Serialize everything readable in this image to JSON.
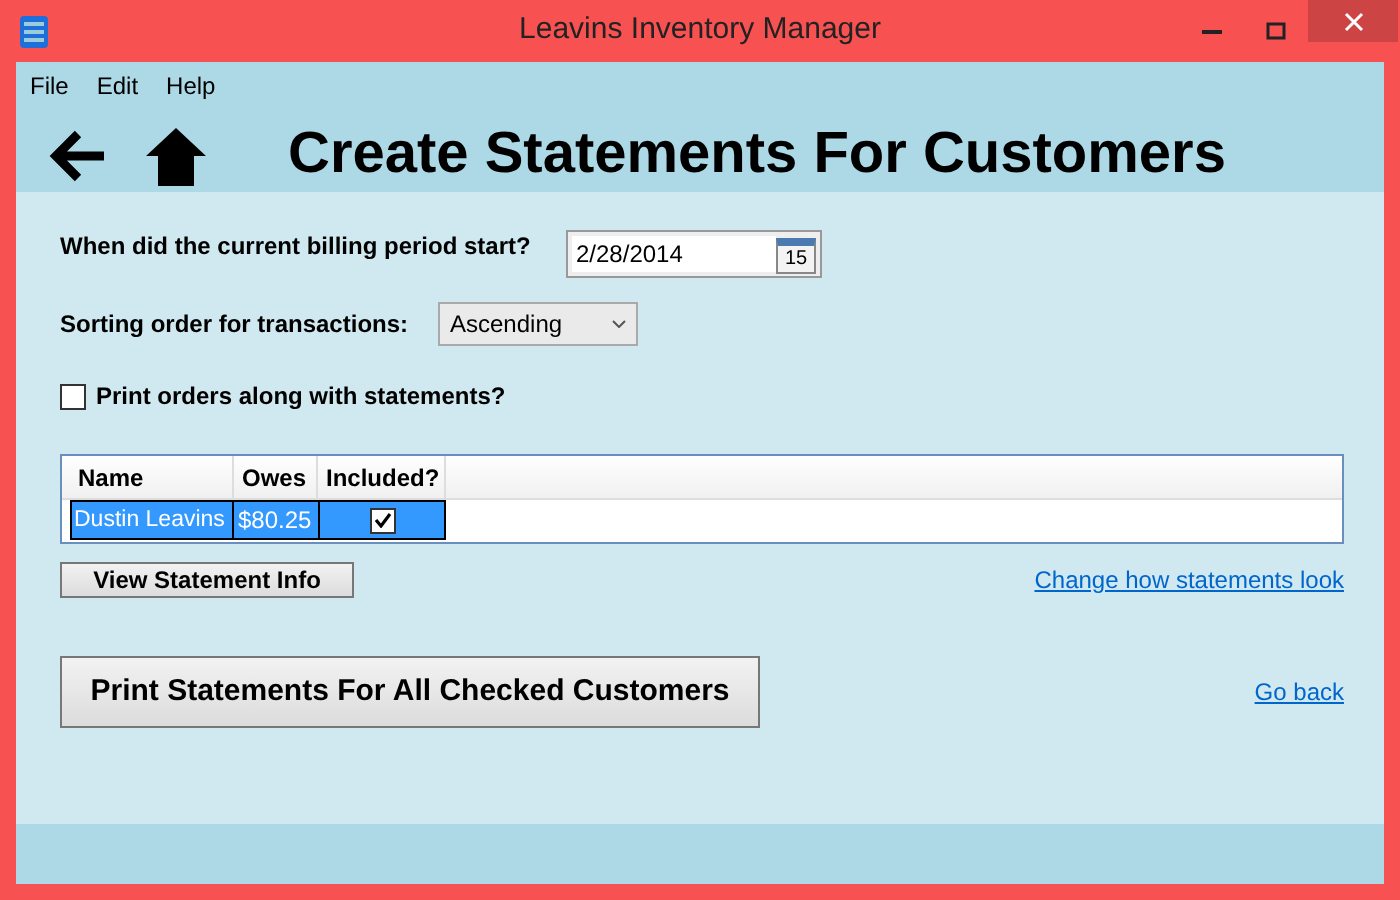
{
  "window": {
    "title": "Leavins Inventory Manager"
  },
  "menu": [
    "File",
    "Edit",
    "Help"
  ],
  "header": {
    "title": "Create Statements For Customers"
  },
  "billing": {
    "label": "When did the current billing period start?",
    "value": "2/28/2014",
    "calendar_day": "15"
  },
  "sorting": {
    "label": "Sorting order for transactions:",
    "value": "Ascending"
  },
  "print_orders": {
    "label": "Print orders along with statements?",
    "checked": false
  },
  "table": {
    "columns": [
      "Name",
      "Owes",
      "Included?"
    ],
    "rows": [
      {
        "name": "Dustin Leavins",
        "owes": "$80.25",
        "included": true,
        "selected": true
      }
    ]
  },
  "view_button": "View Statement Info",
  "change_link": "Change how statements look",
  "print_button": "Print Statements For All Checked Customers",
  "back_link": "Go back"
}
